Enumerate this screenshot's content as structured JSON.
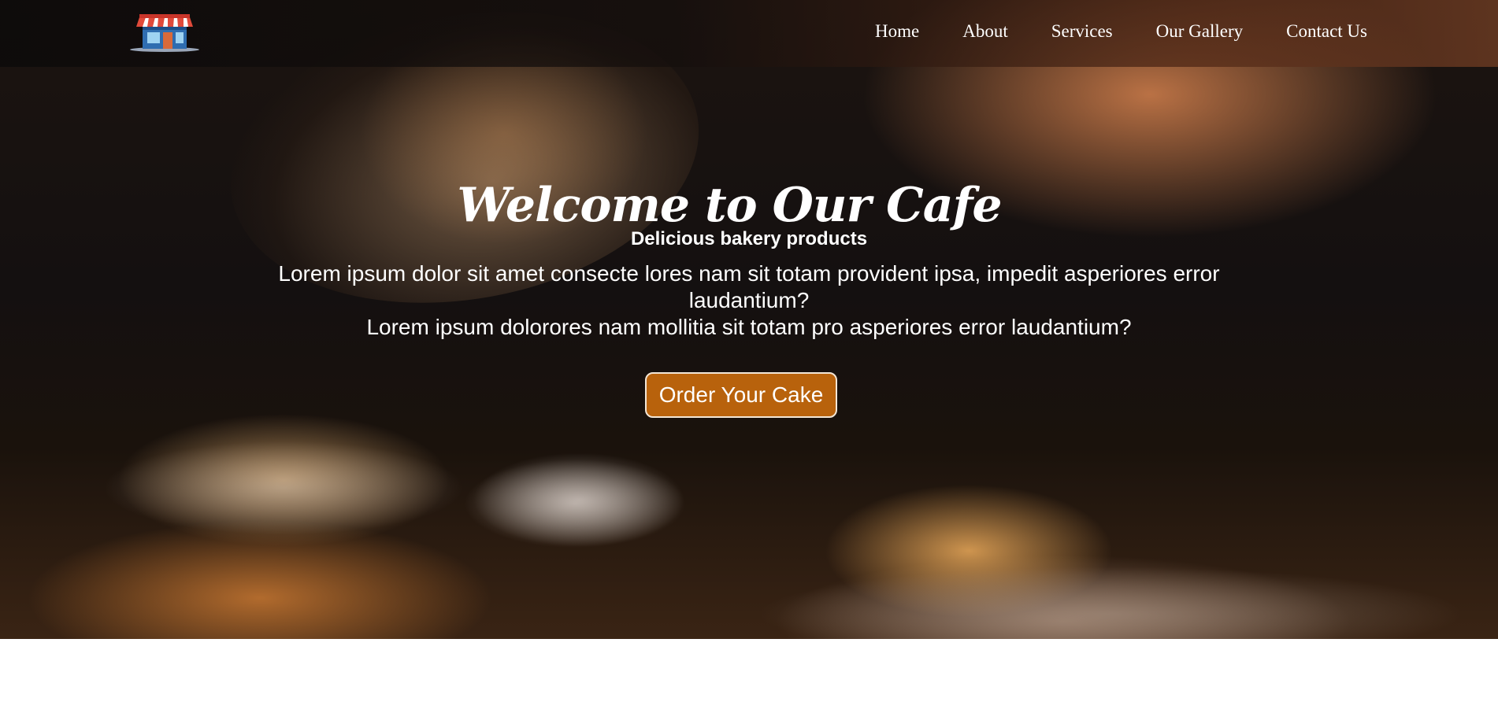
{
  "brand": {
    "logo_icon": "storefront-icon"
  },
  "nav": {
    "items": [
      {
        "label": "Home"
      },
      {
        "label": "About"
      },
      {
        "label": "Services"
      },
      {
        "label": "Our Gallery"
      },
      {
        "label": "Contact Us"
      }
    ]
  },
  "hero": {
    "title": "Welcome to Our Cafe",
    "subtitle": "Delicious bakery products",
    "line1": "Lorem ipsum dolor sit amet consecte lores nam sit totam provident ipsa, impedit asperiores error laudantium?",
    "line2": "Lorem ipsum dolorores nam mollitia sit totam pro asperiores error laudantium?",
    "cta_label": "Order Your Cake"
  },
  "colors": {
    "accent": "#b8620c",
    "text": "#ffffff"
  }
}
